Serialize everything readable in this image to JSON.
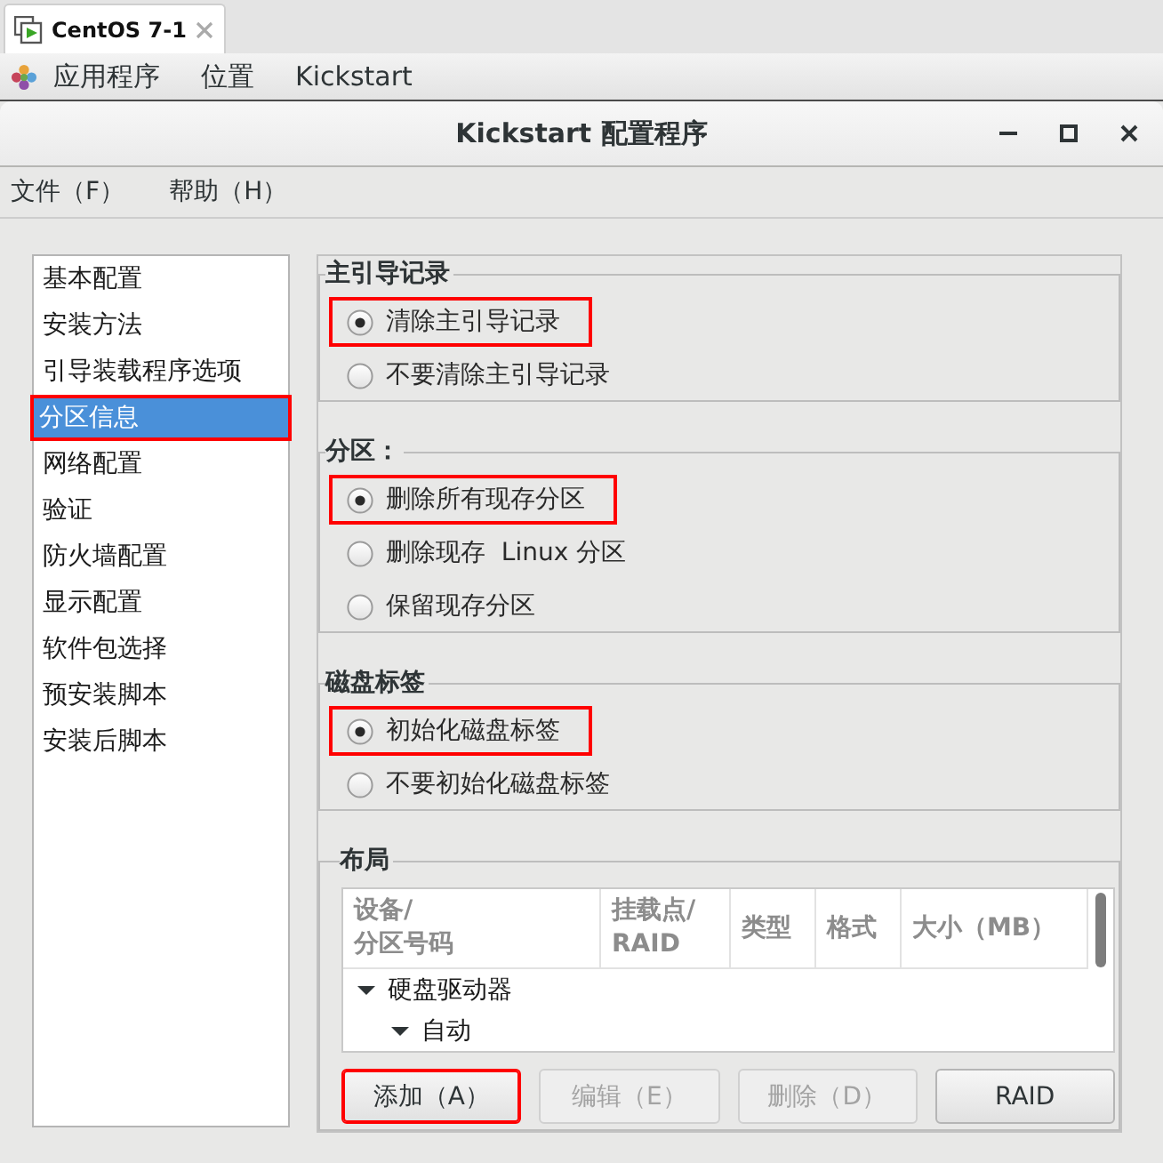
{
  "tab_bar": {
    "tabs": [
      {
        "label": "CentOS 7-1",
        "selected": true
      }
    ]
  },
  "top_bar": {
    "menus": [
      "应用程序",
      "位置",
      "Kickstart"
    ]
  },
  "window": {
    "title": "Kickstart 配置程序"
  },
  "menu_bar": [
    "文件（F）",
    "帮助（H）"
  ],
  "sidebar": {
    "items": [
      {
        "label": "基本配置",
        "selected": false,
        "highlighted": false
      },
      {
        "label": "安装方法",
        "selected": false,
        "highlighted": false
      },
      {
        "label": "引导装载程序选项",
        "selected": false,
        "highlighted": false
      },
      {
        "label": "分区信息",
        "selected": true,
        "highlighted": true
      },
      {
        "label": "网络配置",
        "selected": false,
        "highlighted": false
      },
      {
        "label": "验证",
        "selected": false,
        "highlighted": false
      },
      {
        "label": "防火墙配置",
        "selected": false,
        "highlighted": false
      },
      {
        "label": "显示配置",
        "selected": false,
        "highlighted": false
      },
      {
        "label": "软件包选择",
        "selected": false,
        "highlighted": false
      },
      {
        "label": "预安装脚本",
        "selected": false,
        "highlighted": false
      },
      {
        "label": "安装后脚本",
        "selected": false,
        "highlighted": false
      }
    ]
  },
  "sections": [
    {
      "title": "主引导记录",
      "options": [
        {
          "label": "清除主引导记录",
          "selected": true,
          "highlighted": true
        },
        {
          "label": "不要清除主引导记录",
          "selected": false,
          "highlighted": false
        }
      ]
    },
    {
      "title": "分区：",
      "options": [
        {
          "label": "删除所有现存分区",
          "selected": true,
          "highlighted": true
        },
        {
          "label": "删除现存  Linux 分区",
          "selected": false,
          "highlighted": false
        },
        {
          "label": "保留现存分区",
          "selected": false,
          "highlighted": false
        }
      ]
    },
    {
      "title": "磁盘标签",
      "options": [
        {
          "label": "初始化磁盘标签",
          "selected": true,
          "highlighted": true
        },
        {
          "label": "不要初始化磁盘标签",
          "selected": false,
          "highlighted": false
        }
      ]
    }
  ],
  "layout": {
    "title": "布局",
    "table": {
      "columns": [
        "设备/\n分区号码",
        "挂载点/\nRAID",
        "类型",
        "格式",
        "大小（MB）"
      ],
      "rows": [
        {
          "label": "硬盘驱动器",
          "expanded": true,
          "children": [
            {
              "label": "自动",
              "expanded": true
            }
          ]
        }
      ]
    },
    "buttons": [
      {
        "label": "添加（A）",
        "disabled": false,
        "highlighted": true
      },
      {
        "label": "编辑（E）",
        "disabled": true,
        "highlighted": false
      },
      {
        "label": "删除（D）",
        "disabled": true,
        "highlighted": false
      },
      {
        "label": "RAID",
        "disabled": false,
        "highlighted": false
      }
    ]
  }
}
